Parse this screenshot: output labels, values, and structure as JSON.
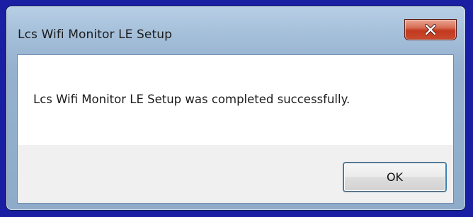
{
  "window": {
    "title": "Lcs Wifi Monitor LE Setup",
    "close_icon": "close-x-icon"
  },
  "message": {
    "text": "Lcs Wifi Monitor LE Setup was completed successfully."
  },
  "buttons": {
    "ok_label": "OK"
  },
  "colors": {
    "desktop_background": "#1a1ea3",
    "close_button": "#c2391f",
    "default_button_focus": "#3c7fb1"
  }
}
